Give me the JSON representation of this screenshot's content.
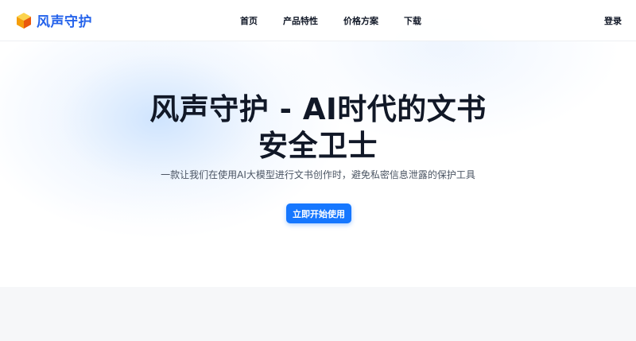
{
  "brand": {
    "name": "风声守护",
    "logo_icon": "cube-logo-icon",
    "colors": {
      "accent": "#2563eb",
      "logo_top": "#fbbf24",
      "logo_side": "#f97316"
    }
  },
  "nav": {
    "items": [
      {
        "label": "首页"
      },
      {
        "label": "产品特性"
      },
      {
        "label": "价格方案"
      },
      {
        "label": "下载"
      }
    ],
    "login_label": "登录"
  },
  "hero": {
    "title_line1": "风声守护 - AI时代的文书",
    "title_line2": "安全卫士",
    "subtitle": "一款让我们在使用AI大模型进行文书创作时，避免私密信息泄露的保护工具",
    "cta_label": "立即开始使用",
    "cta_color": "#1677ff"
  }
}
